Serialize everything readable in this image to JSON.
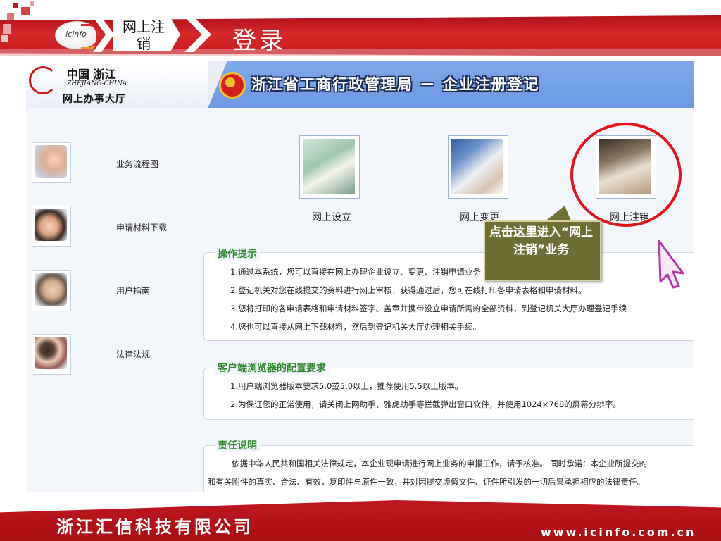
{
  "header": {
    "logo_text": "icinfo",
    "breadcrumb": "网上注销",
    "slide_title": "登录"
  },
  "portal": {
    "province_cn": "中国 浙江",
    "province_en": "ZHEJIANG-CHINA",
    "hall": "网上办事大厅",
    "bureau_title": "浙江省工商行政管理局 － 企业注册登记"
  },
  "sidebar": {
    "items": [
      {
        "label": "业务流程图",
        "icon": "hands-photo-icon"
      },
      {
        "label": "申请材料下载",
        "icon": "phone-user-photo-icon"
      },
      {
        "label": "用户指南",
        "icon": "man-glasses-photo-icon"
      },
      {
        "label": "法律法规",
        "icon": "woman-photo-icon"
      }
    ]
  },
  "services": [
    {
      "label": "网上设立",
      "icon": "fountain-pen-photo-icon"
    },
    {
      "label": "网上变更",
      "icon": "signing-hand-photo-icon"
    },
    {
      "label": "网上注销",
      "icon": "pen-nib-photo-icon"
    }
  ],
  "sections": {
    "tips": {
      "title": "操作提示",
      "lines": [
        "1.通过本系统，您可以直接在网上办理企业设立、变更、注销申请业务",
        "2.登记机关对您在线提交的资料进行网上审核，获得通过后，您可在线打印各申请表格和申请材料。",
        "3.您将打印的各申请表格和申请材料签字、盖章并携带设立申请所需的全部资料，到登记机关大厅办理登记手续",
        "4.您也可以直接从网上下载材料，然后到登记机关大厅办理相关手续。"
      ]
    },
    "browser": {
      "title": "客户端浏览器的配置要求",
      "lines": [
        "1.用户端浏览器版本要求5.0或5.0以上，推荐使用5.5以上版本。",
        "2.为保证您的正常使用，请关闭上网助手、雅虎助手等拦截弹出窗口软件，并使用1024×768的屏幕分辨率。"
      ]
    },
    "liability": {
      "title": "责任说明",
      "lines": [
        "依据中华人民共和国相关法律规定，本企业现申请进行网上业务的申报工作，请予核准。  同时承诺：本企业所提交的",
        "和有关附件的真实、合法、有效，复印件与原件一致，并对因提交虚假文件、证件所引发的一切后果承担相应的法律责任。"
      ]
    }
  },
  "callout": {
    "text": "点击这里进入“网上注销”业务"
  },
  "footer": {
    "company": "浙江汇信科技有限公司",
    "url": "www.icinfo.com.cn"
  },
  "colors": {
    "brand_red": "#c4161c",
    "portal_blue": "#6b99e3",
    "section_green": "#2d8a2d",
    "callout_olive": "#6f6f34"
  }
}
